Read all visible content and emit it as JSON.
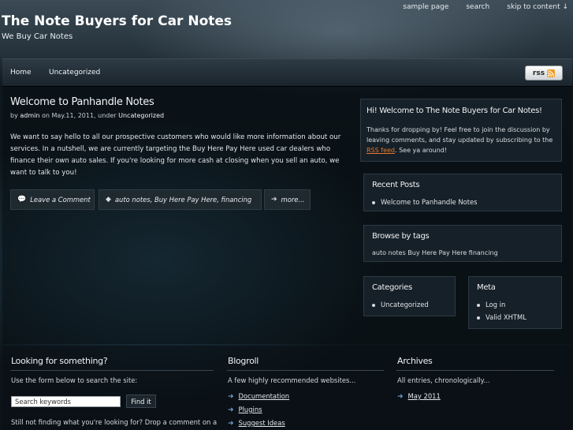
{
  "header": {
    "site_title": "The Note Buyers for Car Notes",
    "tagline": "We Buy Car Notes",
    "top_links": [
      "sample page",
      "search",
      "skip to content ↓"
    ]
  },
  "nav": {
    "items": [
      "Home",
      "Uncategorized"
    ],
    "rss_label": "rss"
  },
  "post": {
    "title": "Welcome to Panhandle Notes",
    "meta_by": "by",
    "author": "admin",
    "meta_on": "on May.11, 2011, under",
    "category": "Uncategorized",
    "body": "We want to say hello to all our prospective customers who would like more information about our services. In a nutshell, we are currently targeting the Buy Here Pay Here used car dealers who finance their own auto sales. If you're looking for more cash at closing when you sell an auto, we want to talk to you!",
    "buttons": {
      "comment": "Leave a Comment",
      "tags": "auto notes, Buy Here Pay Here, financing",
      "more": "more..."
    }
  },
  "sidebar": {
    "welcome": {
      "title": "Hi! Welcome to The Note Buyers for Car Notes!",
      "text_before": "Thanks for dropping by! Feel free to join the discussion by leaving comments, and stay updated by subscribing to the",
      "link": "RSS feed",
      "text_after": ". See ya around!"
    },
    "recent_posts": {
      "title": "Recent Posts",
      "items": [
        "Welcome to Panhandle Notes"
      ]
    },
    "tags": {
      "title": "Browse by tags",
      "text": "auto notes Buy Here Pay Here financing"
    },
    "categories": {
      "title": "Categories",
      "items": [
        "Uncategorized"
      ]
    },
    "meta": {
      "title": "Meta",
      "items": [
        "Log in",
        "Valid XHTML"
      ]
    }
  },
  "footer": {
    "search": {
      "title": "Looking for something?",
      "text": "Use the form below to search the site:",
      "value": "Search keywords",
      "button": "Find it",
      "bottom_text": "Still not finding what you're looking for? Drop a comment on a"
    },
    "blogroll": {
      "title": "Blogroll",
      "text": "A few highly recommended websites...",
      "links": [
        "Documentation",
        "Plugins",
        "Suggest Ideas"
      ]
    },
    "archives": {
      "title": "Archives",
      "text": "All entries, chronologically...",
      "links": [
        "May 2011"
      ]
    }
  },
  "colors": {
    "link_orange": "#e6782a",
    "arrow_blue": "#6e9fd4",
    "rss_orange": "#f39a1d"
  }
}
